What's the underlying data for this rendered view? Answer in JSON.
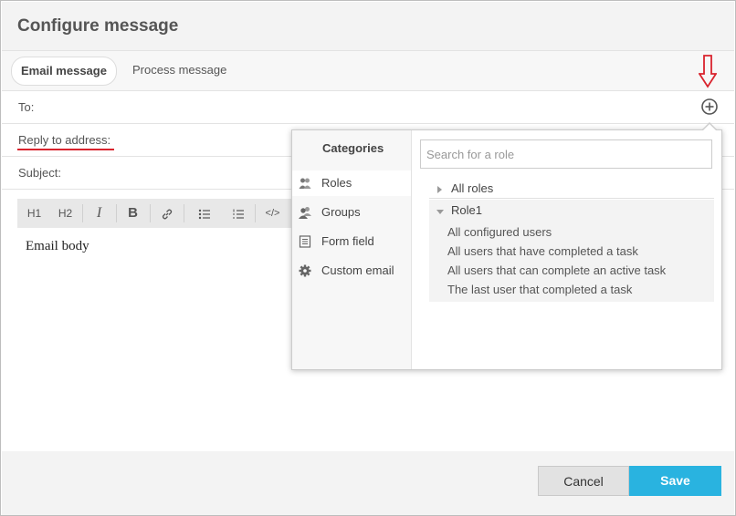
{
  "dialog": {
    "title": "Configure message"
  },
  "tabs": [
    {
      "label": "Email message",
      "active": true
    },
    {
      "label": "Process message",
      "active": false
    }
  ],
  "fields": {
    "to_label": "To:",
    "reply_label": "Reply to address:",
    "subject_label": "Subject:"
  },
  "toolbar": {
    "h1": "H1",
    "h2": "H2",
    "italic": "I",
    "bold": "B",
    "code": "</>"
  },
  "editor": {
    "body": "Email body"
  },
  "popup": {
    "categories_caption": "Categories",
    "categories": [
      {
        "label": "Roles",
        "icon": "roles-icon",
        "selected": true
      },
      {
        "label": "Groups",
        "icon": "groups-icon",
        "selected": false
      },
      {
        "label": "Form field",
        "icon": "form-field-icon",
        "selected": false
      },
      {
        "label": "Custom email",
        "icon": "gear-icon",
        "selected": false
      }
    ],
    "search_placeholder": "Search for a role",
    "tree": {
      "all_roles": "All roles",
      "role1": "Role1",
      "role1_options": [
        "All configured users",
        "All users that have completed a task",
        "All users that can complete an active task",
        "The last user that completed a task"
      ]
    }
  },
  "footer": {
    "cancel_label": "Cancel",
    "save_label": "Save"
  },
  "colors": {
    "accent": "#29b3e0",
    "highlight": "#d9232d"
  }
}
